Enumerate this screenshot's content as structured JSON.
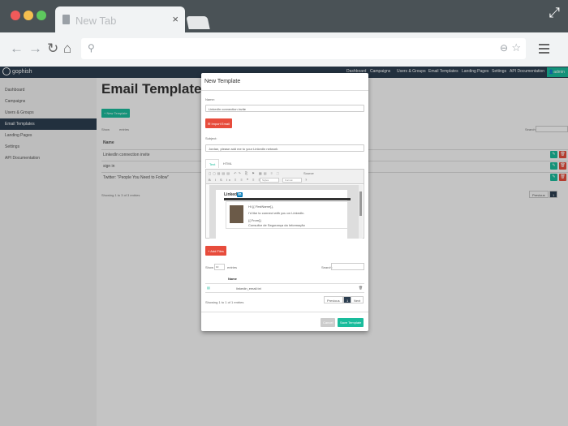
{
  "browser": {
    "tab_title": "New Tab",
    "close": "×",
    "colors": {
      "red": "#f05a5a",
      "yellow": "#f5bf4f",
      "green": "#5ec85e"
    }
  },
  "app": {
    "brand": "gophish",
    "nav": [
      "Dashboard",
      "Campaigns",
      "Users & Groups",
      "Email Templates",
      "Landing Pages",
      "Settings",
      "API Documentation"
    ],
    "user": "admin",
    "sidebar": [
      "Dashboard",
      "Campaigns",
      "Users & Groups",
      "Email Templates",
      "Landing Pages",
      "Settings",
      "API Documentation"
    ],
    "page_title": "Email Templates",
    "new_button": "+ New Template",
    "show": "Show",
    "entries": "entries",
    "search": "Search:",
    "col_name": "Name",
    "rows": [
      "LinkedIn connection invite",
      "sign in",
      "Twitter: \"People You Need to Follow\""
    ],
    "showing": "Showing 1 to 3 of 3 entries",
    "previous": "Previous",
    "page": "1"
  },
  "modal": {
    "title": "New Template",
    "name_label": "Name:",
    "name_value": "LinkedIn connection invite",
    "import_button": "Import Email",
    "subject_label": "Subject:",
    "subject_value": "Jordan, please add me to your LinkedIn network",
    "tab_text": "Text",
    "tab_html": "HTML",
    "toolbar_row1": "Source",
    "styles": "Styles",
    "format": "Format",
    "email": {
      "greeting": "Hi {{.FirstName}},",
      "line": "I'd like to connect with you on LinkedIn.",
      "sig1": "{{.From}}",
      "sig2": "Consultor de Segurança da Informação"
    },
    "add_files": "+ Add Files",
    "show": "Show",
    "show_value": "10",
    "entries": "entries",
    "search": "Search:",
    "col_name": "Name",
    "file": "linkedin_email.txt",
    "showing": "Showing 1 to 1 of 1 entries",
    "previous": "Previous",
    "page": "1",
    "next": "Next",
    "cancel": "Cancel",
    "save": "Save Template"
  }
}
